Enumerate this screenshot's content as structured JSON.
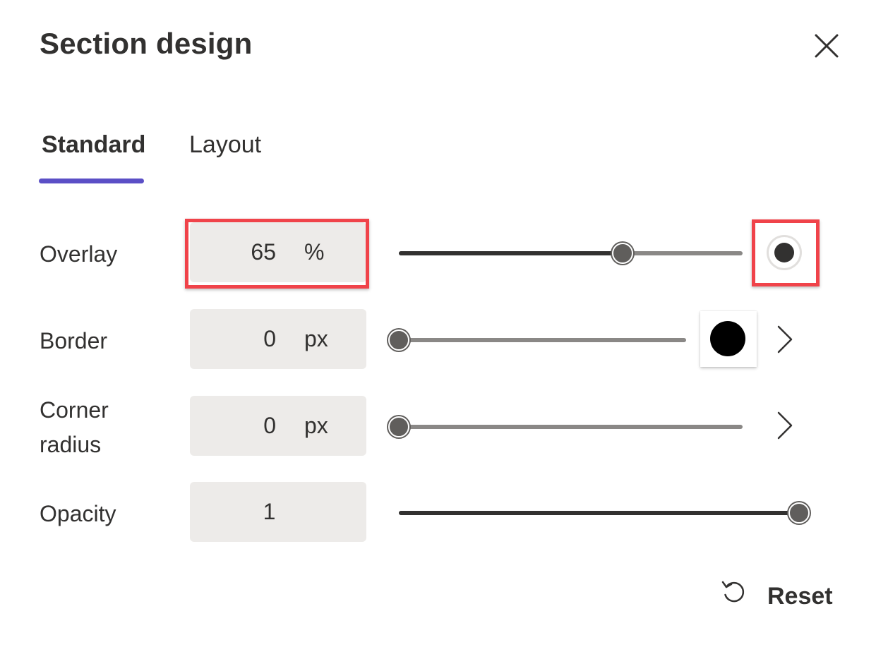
{
  "panel": {
    "title": "Section design",
    "close_icon": "close-icon"
  },
  "tabs": [
    {
      "label": "Standard",
      "selected": true
    },
    {
      "label": "Layout",
      "selected": false
    }
  ],
  "accent_color": "#5b4fc6",
  "highlight_color": "#f0434a",
  "rows": {
    "overlay": {
      "label": "Overlay",
      "value": "65",
      "unit": "%",
      "slider_fraction": 0.65,
      "color_option": "dark-circle"
    },
    "border": {
      "label": "Border",
      "value": "0",
      "unit": "px",
      "slider_fraction": 0.0,
      "color": "#000000",
      "chevron_icon": "chevron-right-icon"
    },
    "corner_radius": {
      "label_line1": "Corner",
      "label_line2": "radius",
      "value": "0",
      "unit": "px",
      "slider_fraction": 0.0,
      "chevron_icon": "chevron-right-icon"
    },
    "opacity": {
      "label": "Opacity",
      "value": "1",
      "slider_fraction": 1.0
    }
  },
  "footer": {
    "reset_label": "Reset",
    "reset_icon": "reset-icon"
  }
}
